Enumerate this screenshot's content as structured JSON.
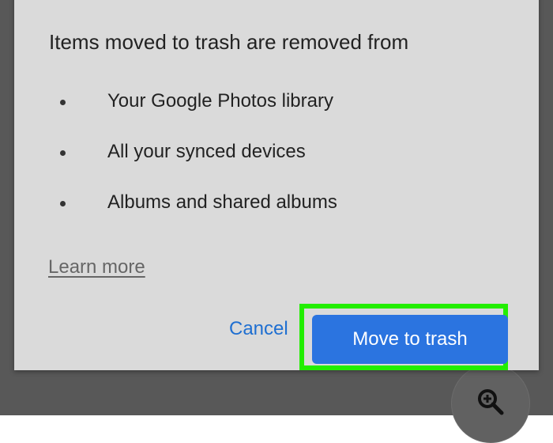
{
  "dialog": {
    "title": "Items moved to trash are removed from",
    "items": [
      "Your Google Photos library",
      "All your synced devices",
      "Albums and shared albums"
    ],
    "learn_more": "Learn more",
    "cancel_label": "Cancel",
    "confirm_label": "Move to trash"
  },
  "icons": {
    "zoom": "zoom-in-icon"
  },
  "colors": {
    "accent": "#2b74e0",
    "highlight": "#22ee00"
  }
}
